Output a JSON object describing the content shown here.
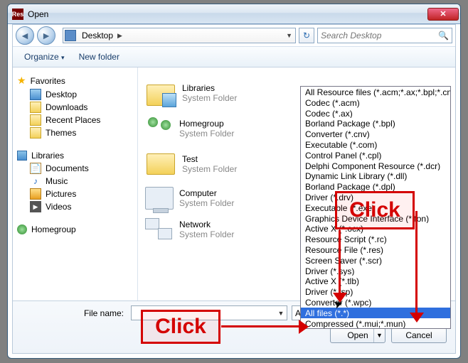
{
  "window": {
    "title": "Open"
  },
  "nav": {
    "location": "Desktop"
  },
  "search": {
    "placeholder": "Search Desktop"
  },
  "toolbar": {
    "organize": "Organize",
    "newfolder": "New folder"
  },
  "sidebar": {
    "fav_header": "Favorites",
    "favs": {
      "desktop": "Desktop",
      "downloads": "Downloads",
      "recent": "Recent Places",
      "themes": "Themes"
    },
    "lib_header": "Libraries",
    "libs": {
      "documents": "Documents",
      "music": "Music",
      "pictures": "Pictures",
      "videos": "Videos"
    },
    "homegroup": "Homegroup"
  },
  "main": {
    "system_folder": "System Folder",
    "items": {
      "libraries": "Libraries",
      "homegroup": "Homegroup",
      "test": "Test",
      "computer": "Computer",
      "network": "Network"
    }
  },
  "bottom": {
    "filename_label": "File name:",
    "type_value": "All Resource files (*.acm;*.ax;*.b",
    "open": "Open",
    "cancel": "Cancel"
  },
  "filetypes": [
    "All Resource files (*.acm;*.ax;*.bpl;*.cnv;*.co",
    "Codec (*.acm)",
    "Codec (*.ax)",
    "Borland Package (*.bpl)",
    "Converter (*.cnv)",
    "Executable (*.com)",
    "Control Panel (*.cpl)",
    "Delphi Component Resource (*.dcr)",
    "Dynamic Link Library (*.dll)",
    "Borland Package (*.dpl)",
    "Driver (*.drv)",
    "Executable (*.exe)",
    "Graphics Device Interface (*.fon)",
    "Active X (*.ocx)",
    "Resource Script (*.rc)",
    "Resource File (*.res)",
    "Screen Saver (*.scr)",
    "Driver (*.sys)",
    "Active X (*.tlb)",
    "Driver (*.tsp)",
    "Converter (*.wpc)",
    "All files (*.*)",
    "Compressed (*.mui;*.mun)"
  ],
  "selected_type_index": 21,
  "annotations": {
    "click": "Click"
  }
}
